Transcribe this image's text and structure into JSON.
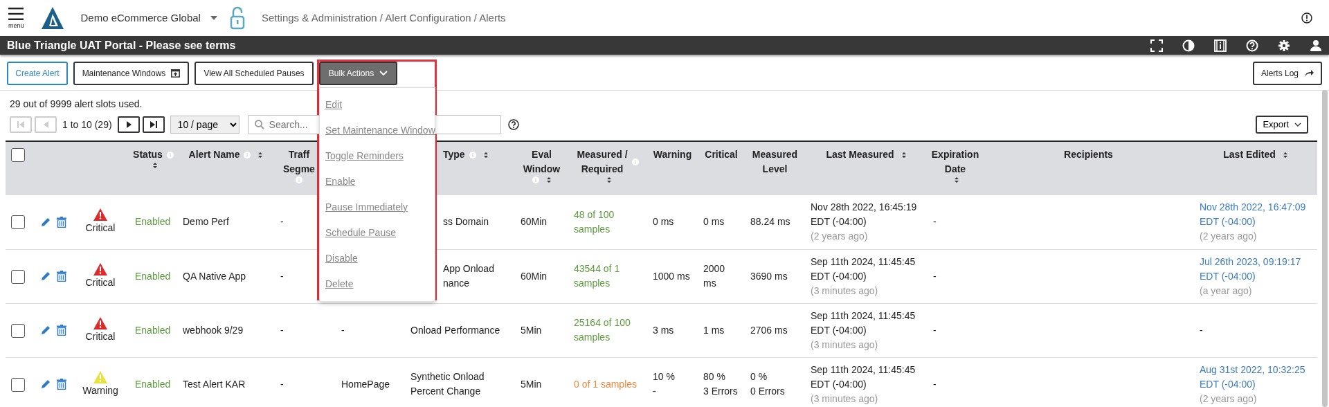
{
  "header": {
    "menu_label": "menu",
    "org": "Demo eCommerce Global",
    "breadcrumb": "Settings & Administration / Alert Configuration / Alerts"
  },
  "banner": {
    "title": "Blue Triangle UAT Portal - Please see terms"
  },
  "toolbar": {
    "buttons": [
      {
        "label": "Create Alert",
        "kind": "primary"
      },
      {
        "label": "Maintenance Windows",
        "kind": "window"
      },
      {
        "label": "View All Scheduled Pauses",
        "kind": "plain"
      },
      {
        "label": "Bulk Actions",
        "kind": "dropdown",
        "expanded": true
      }
    ],
    "right_button": "Alerts Log"
  },
  "bulk_menu": {
    "highlighted": true,
    "items": [
      "Edit",
      "Set Maintenance Window",
      "Toggle Reminders",
      "Enable",
      "Pause Immediately",
      "Schedule Pause",
      "Disable",
      "Delete"
    ]
  },
  "usage": "29 out of 9999 alert slots used.",
  "pager": {
    "buttons": [
      {
        "kind": "first",
        "disabled": true
      },
      {
        "kind": "prev",
        "disabled": true
      },
      {
        "kind": "next",
        "disabled": false
      },
      {
        "kind": "last",
        "disabled": false
      }
    ],
    "range": "1 to 10 (29)",
    "page_size": "10 / page",
    "search_placeholder": "Search...",
    "export": "Export"
  },
  "table": {
    "columns": [
      {
        "kind": "checkbox",
        "checked": false
      },
      {
        "kind": "actions"
      },
      {
        "kind": "severity"
      },
      {
        "lines": [
          "Status"
        ],
        "info": true,
        "sortable": true
      },
      {
        "lines": [
          "Alert Name"
        ],
        "info": true,
        "sortable": true
      },
      {
        "lines": [
          "Traff",
          "Segme"
        ],
        "info": true
      },
      {
        "kind": "blank"
      },
      {
        "lines": [
          "Type"
        ],
        "info": true,
        "sortable": true,
        "clipped": true
      },
      {
        "lines": [
          "Eval",
          "Window"
        ],
        "info": true,
        "sortable": true
      },
      {
        "lines": [
          "Measured /",
          "Required"
        ],
        "info": true,
        "sortable": true
      },
      {
        "lines": [
          "Warning"
        ]
      },
      {
        "lines": [
          "Critical"
        ]
      },
      {
        "lines": [
          "Measured",
          "Level"
        ]
      },
      {
        "lines": [
          "Last Measured"
        ],
        "sortable": true
      },
      {
        "lines": [
          "Expiration",
          "Date"
        ],
        "sortable": true
      },
      {
        "lines": [
          "Recipients"
        ]
      },
      {
        "lines": [
          "Last Edited"
        ],
        "sortable": true
      }
    ],
    "rows": [
      {
        "checked": false,
        "severity": {
          "color": "#dd2b2b",
          "label": "Critical"
        },
        "status": "Enabled",
        "name": "Demo Perf",
        "traffic_segment": "-",
        "column_7": null,
        "alert_type": {
          "lines": [
            "ss Domain"
          ],
          "clipped": true
        },
        "eval_window": "60Min",
        "measured_required": {
          "text": "48 of 100 samples",
          "met": true
        },
        "warning": [
          "0 ms"
        ],
        "critical": [
          "0 ms"
        ],
        "measured_level": [
          "88.24 ms"
        ],
        "last_measured": {
          "date": "Nov 28th 2022, 16:45:19 EDT (-04:00)",
          "ago": "(2 years ago)"
        },
        "expiration_date": "-",
        "last_edited": {
          "date": "Nov 28th 2022, 16:47:09 EDT (-04:00)",
          "ago": "(2 years ago)",
          "link": true
        }
      },
      {
        "checked": false,
        "severity": {
          "color": "#dd2b2b",
          "label": "Critical"
        },
        "status": "Enabled",
        "name": "QA Native App",
        "traffic_segment": "-",
        "column_7": null,
        "alert_type": {
          "lines": [
            "App Onload",
            "nance"
          ],
          "clipped": true
        },
        "eval_window": "60Min",
        "measured_required": {
          "text": "43544 of 1 samples",
          "met": true
        },
        "warning": [
          "1000 ms"
        ],
        "critical": [
          "2000",
          "ms"
        ],
        "measured_level": [
          "3690 ms"
        ],
        "last_measured": {
          "date": "Sep 11th 2024, 11:45:45 EDT (-04:00)",
          "ago": "(3 minutes ago)"
        },
        "expiration_date": "-",
        "last_edited": {
          "date": "Jul 26th 2023, 09:19:17 EDT (-04:00)",
          "ago": "(a year ago)",
          "link": true
        }
      },
      {
        "checked": false,
        "severity": {
          "color": "#dd2b2b",
          "label": "Critical"
        },
        "status": "Enabled",
        "name": "webhook 9/29",
        "traffic_segment": "-",
        "column_7": "-",
        "alert_type": {
          "lines": [
            "Onload Performance"
          ],
          "clipped": false
        },
        "eval_window": "5Min",
        "measured_required": {
          "text": "25164 of 100 samples",
          "met": true
        },
        "warning": [
          "3 ms"
        ],
        "critical": [
          "1 ms"
        ],
        "measured_level": [
          "2706 ms"
        ],
        "last_measured": {
          "date": "Sep 11th 2024, 11:45:45 EDT (-04:00)",
          "ago": "(3 minutes ago)"
        },
        "expiration_date": "-",
        "last_edited": {
          "date": "-",
          "link": false
        }
      },
      {
        "checked": false,
        "severity": {
          "color": "#e8e23a",
          "label": "Warning"
        },
        "status": "Enabled",
        "name": "Test Alert KAR",
        "traffic_segment": "-",
        "column_7": "HomePage",
        "alert_type": {
          "lines": [
            "Synthetic Onload",
            "Percent Change"
          ],
          "clipped": false
        },
        "eval_window": "5Min",
        "measured_required": {
          "text": "0 of 1 samples",
          "met": false
        },
        "warning": [
          "10 %",
          "-"
        ],
        "critical": [
          "80 %",
          "3 Errors"
        ],
        "measured_level": [
          "0 %",
          "0 Errors"
        ],
        "last_measured": {
          "date": "Sep 11th 2024, 11:45:45 EDT (-04:00)",
          "ago": "(3 minutes ago)"
        },
        "expiration_date": "-",
        "last_edited": {
          "date": "Aug 31st 2022, 10:32:25 EDT (-04:00)",
          "ago": "(2 years ago)",
          "link": true
        }
      }
    ]
  }
}
